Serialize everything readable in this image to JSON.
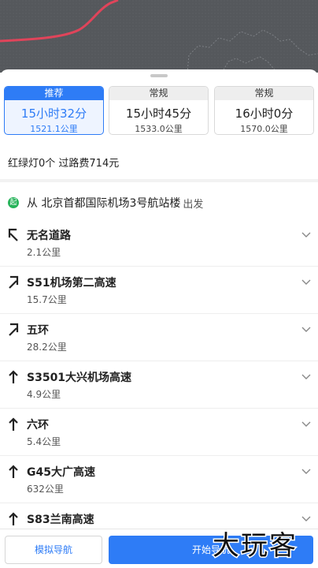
{
  "route_options": [
    {
      "tag": "推荐",
      "time": "15小时32分",
      "distance": "1521.1公里",
      "selected": true
    },
    {
      "tag": "常规",
      "time": "15小时45分",
      "distance": "1533.0公里",
      "selected": false
    },
    {
      "tag": "常规",
      "time": "16小时0分",
      "distance": "1570.0公里",
      "selected": false
    }
  ],
  "summary": "红绿灯0个 过路费714元",
  "start": {
    "badge": "起",
    "text": "从 北京首都国际机场3号航站楼",
    "suffix": "出发"
  },
  "steps": [
    {
      "road": "无名道路",
      "length": "2.1公里",
      "turn": "turn-left-icon"
    },
    {
      "road": "S51机场第二高速",
      "length": "15.7公里",
      "turn": "turn-right-icon"
    },
    {
      "road": "五环",
      "length": "28.2公里",
      "turn": "turn-right-icon"
    },
    {
      "road": "S3501大兴机场高速",
      "length": "4.9公里",
      "turn": "straight-icon"
    },
    {
      "road": "六环",
      "length": "5.4公里",
      "turn": "straight-icon"
    },
    {
      "road": "G45大广高速",
      "length": "632公里",
      "turn": "straight-icon"
    },
    {
      "road": "S83兰南高速",
      "length": "",
      "turn": "straight-icon"
    }
  ],
  "bottom": {
    "simulate_label": "模拟导航",
    "start_label": "开始导航"
  },
  "watermark": "大玩客",
  "colors": {
    "accent": "#2e7cf6",
    "start_green": "#27b35a",
    "route_red": "#e0445a"
  }
}
